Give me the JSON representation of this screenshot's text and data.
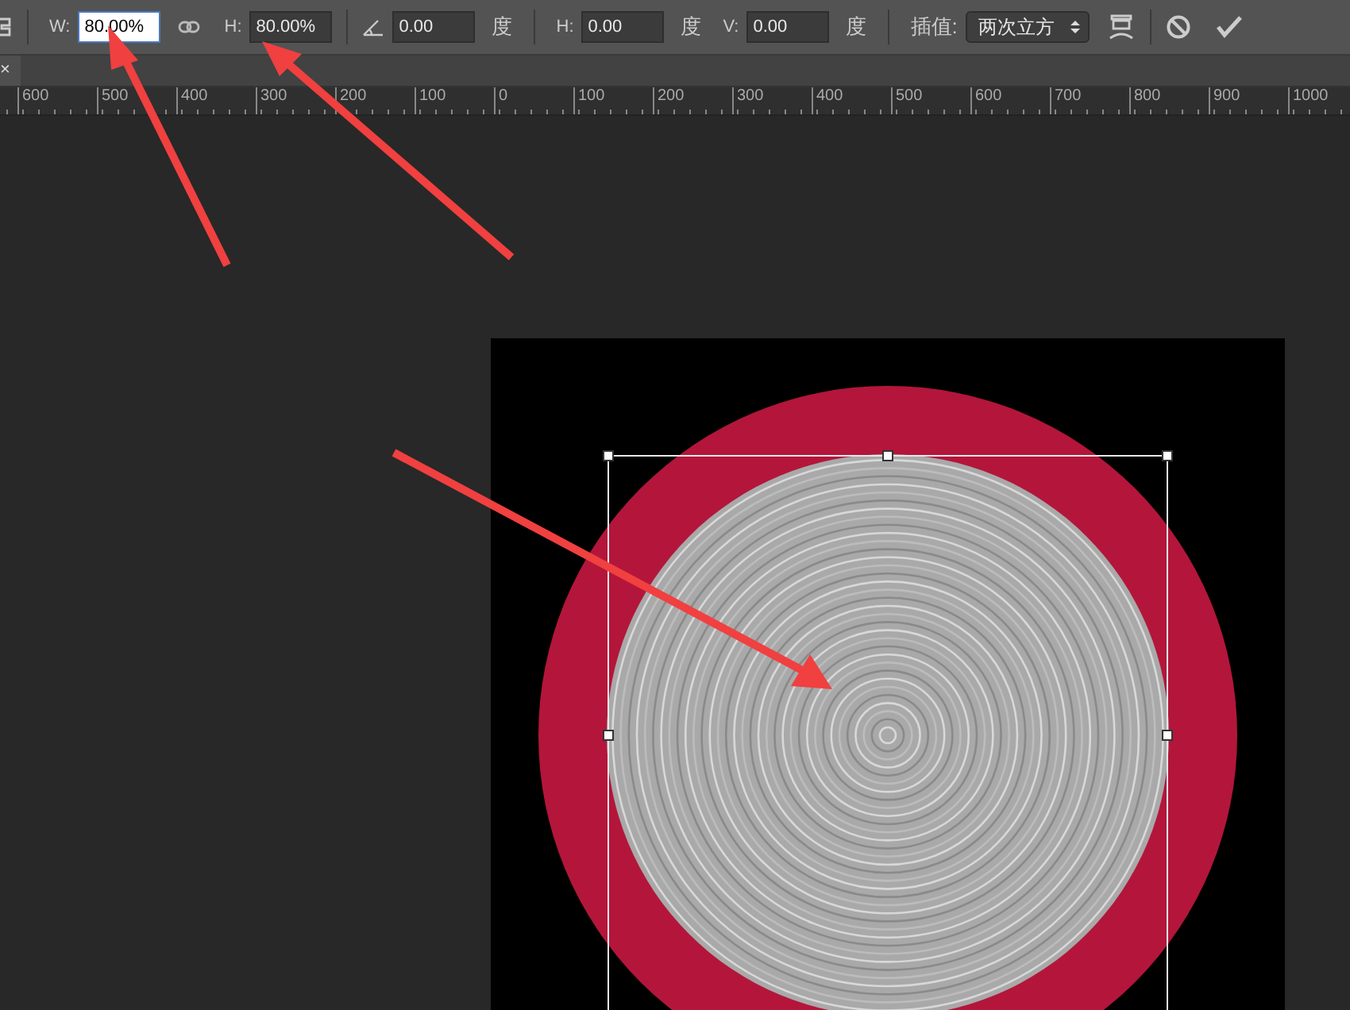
{
  "toolbar": {
    "fields": [
      {
        "kind": "width",
        "label": "W:",
        "value": "80.00%",
        "focused": true
      },
      {
        "kind": "height",
        "label": "H:",
        "value": "80.00%",
        "focused": false
      },
      {
        "kind": "angle",
        "value": "0.00",
        "unit": "度",
        "focused": false
      },
      {
        "kind": "skew",
        "label": "H:",
        "value": "0.00",
        "unit": "度",
        "focused": false
      },
      {
        "kind": "skew",
        "label": "V:",
        "value": "0.00",
        "unit": "度",
        "focused": false
      }
    ],
    "interpolation": {
      "label": "插值:",
      "value": "两次立方"
    }
  },
  "tab": {
    "close": "×"
  },
  "ruler": {
    "labels": [
      "600",
      "500",
      "400",
      "300",
      "200",
      "100",
      "0",
      "100",
      "200",
      "300",
      "400",
      "500",
      "600",
      "700",
      "800",
      "900",
      "1000"
    ]
  }
}
